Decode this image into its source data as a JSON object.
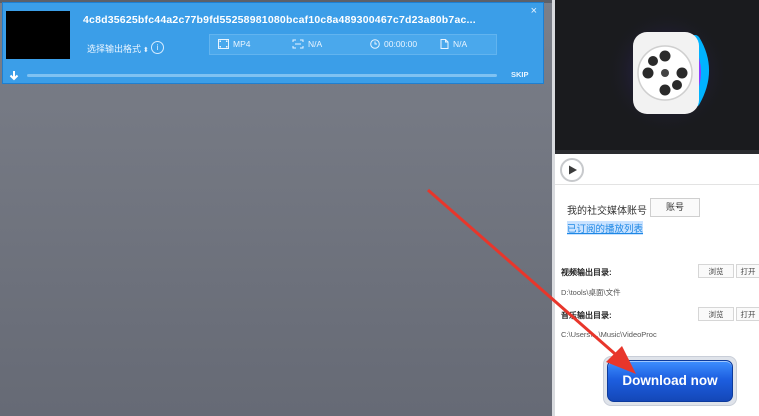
{
  "task": {
    "filename": "4c8d35625bfc44a2c77b9fd55258981080bcaf10c8a489300467c7d23a80b7ac...",
    "format_select_label": "选择输出格式",
    "info_label": "i",
    "meta": {
      "format": "MP4",
      "resolution": "N/A",
      "duration": "00:00:00",
      "size": "N/A"
    },
    "progress": 0,
    "skip_label": "SKIP",
    "close_label": "×"
  },
  "sidebar": {
    "social_label": "我的社交媒体账号",
    "account_button": "账号",
    "subscription_link": "已订阅的播放列表",
    "video_output_label": "视频输出目录:",
    "video_output_path": "D:\\tools\\桌面\\文件",
    "browse_label": "浏览",
    "open_label": "打开",
    "music_output_label": "音乐输出目录:",
    "music_output_path": "C:\\Users\\...\\Music\\VideoProc",
    "download_button": "Download now"
  },
  "colors": {
    "accent_blue": "#3b9ee8",
    "annotation_arrow": "#e8362b",
    "download_button": "#1d5fe0"
  },
  "icons": [
    "film-icon",
    "resolution-icon",
    "clock-icon",
    "file-icon",
    "download-arrow-icon",
    "play-icon",
    "close-icon",
    "info-icon"
  ]
}
